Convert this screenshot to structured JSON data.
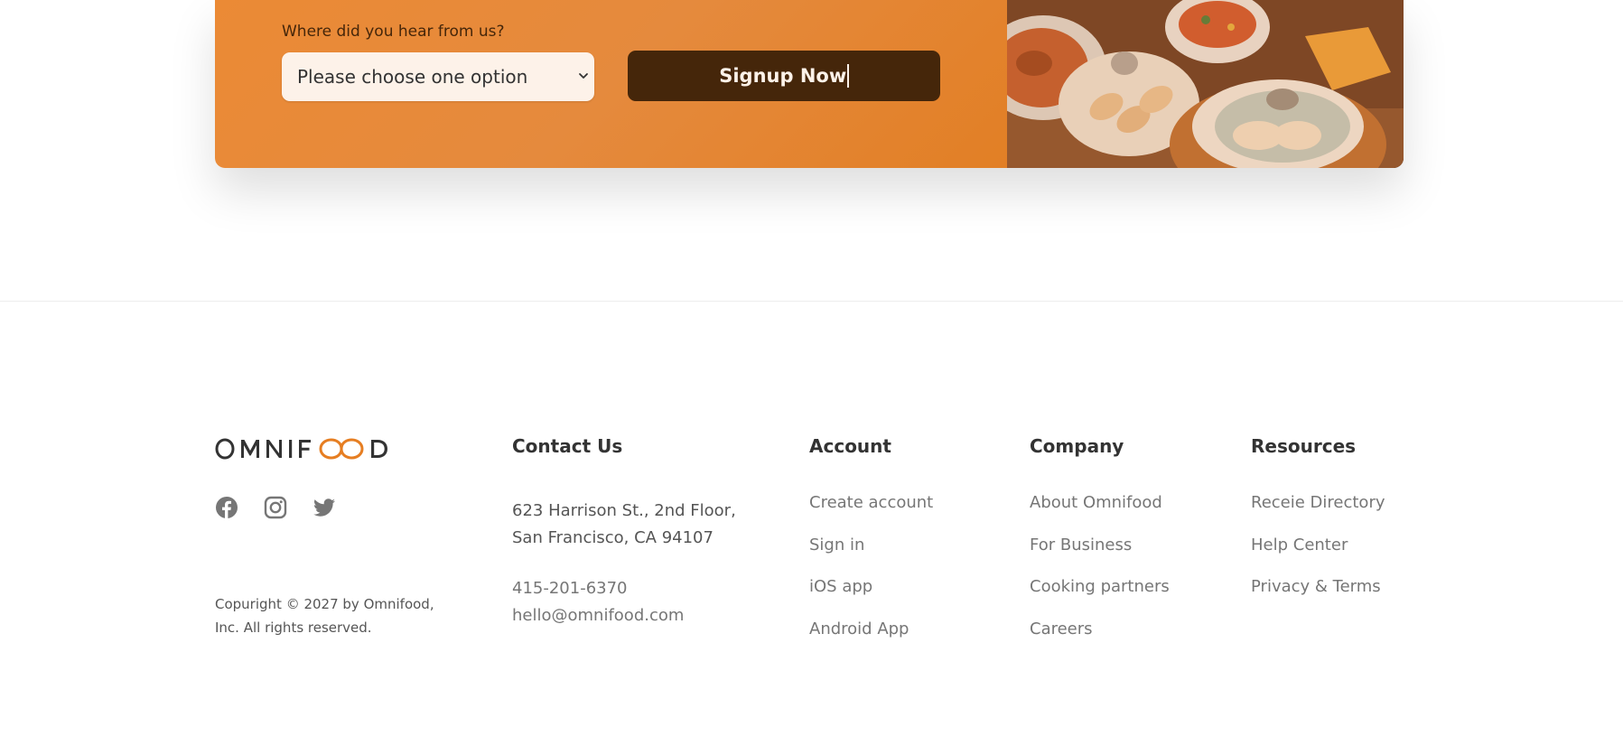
{
  "cta": {
    "form_label": "Where did you hear from us?",
    "select_value": "Please choose one option",
    "signup_label": "Signup Now",
    "brand_color": "#e67e22",
    "button_color": "#45260a"
  },
  "footer": {
    "logo_text": "OMNIFOOD",
    "social_icons": [
      "facebook-icon",
      "instagram-icon",
      "twitter-icon"
    ],
    "copyright": "Copuright © 2027 by Omnifood, Inc. All rights reserved.",
    "contact": {
      "title": "Contact Us",
      "address_line1": "623 Harrison St., 2nd Floor,",
      "address_line2": "San Francisco, CA 94107",
      "phone": "415-201-6370",
      "email": "hello@omnifood.com"
    },
    "account": {
      "title": "Account",
      "links": [
        "Create account",
        "Sign in",
        "iOS app",
        "Android App"
      ]
    },
    "company": {
      "title": "Company",
      "links": [
        "About Omnifood",
        "For Business",
        "Cooking partners",
        "Careers"
      ]
    },
    "resources": {
      "title": "Resources",
      "links": [
        "Receie Directory",
        "Help Center",
        "Privacy & Terms"
      ]
    }
  }
}
